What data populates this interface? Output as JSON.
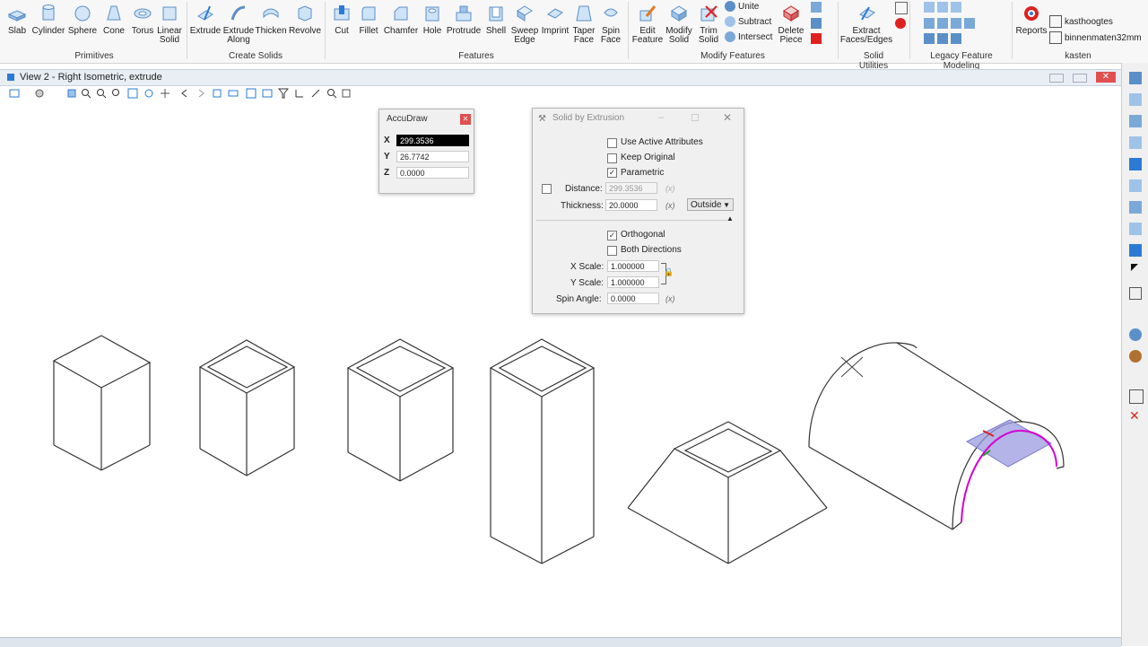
{
  "ribbon": {
    "groups": [
      {
        "label": "Primitives"
      },
      {
        "label": "Create Solids"
      },
      {
        "label": "Features"
      },
      {
        "label": "Modify Features"
      },
      {
        "label": "Solid Utilities"
      },
      {
        "label": "Legacy Feature Modeling"
      },
      {
        "label": "kasten"
      }
    ],
    "buttons": [
      {
        "label": "Slab"
      },
      {
        "label": "Cylinder"
      },
      {
        "label": "Sphere"
      },
      {
        "label": "Cone"
      },
      {
        "label": "Torus"
      },
      {
        "label": "Linear Solid"
      },
      {
        "label": "Extrude"
      },
      {
        "label": "Extrude Along"
      },
      {
        "label": "Thicken"
      },
      {
        "label": "Revolve"
      },
      {
        "label": "Cut"
      },
      {
        "label": "Fillet"
      },
      {
        "label": "Chamfer"
      },
      {
        "label": "Hole"
      },
      {
        "label": "Protrude"
      },
      {
        "label": "Shell"
      },
      {
        "label": "Sweep Edge"
      },
      {
        "label": "Imprint"
      },
      {
        "label": "Taper Face"
      },
      {
        "label": "Spin Face"
      },
      {
        "label": "Edit Feature"
      },
      {
        "label": "Modify Solid"
      },
      {
        "label": "Trim Solid"
      },
      {
        "label": "Delete Piece"
      },
      {
        "label": "Extract Faces/Edges"
      },
      {
        "label": "Reports"
      }
    ],
    "boolean": {
      "unite": "Unite",
      "subtract": "Subtract",
      "intersect": "Intersect"
    },
    "kasten": {
      "item1": "kasthoogtes",
      "item2": "binnenmaten32mm"
    }
  },
  "view": {
    "title": "View 2 - Right Isometric, extrude"
  },
  "accudraw": {
    "title": "AccuDraw",
    "x_label": "X",
    "x_value": "299.3536",
    "y_label": "Y",
    "y_value": "26.7742",
    "z_label": "Z",
    "z_value": "0.0000"
  },
  "extrusion": {
    "title": "Solid by Extrusion",
    "use_active": "Use Active Attributes",
    "keep_original": "Keep Original",
    "parametric": "Parametric",
    "distance_label": "Distance:",
    "distance_value": "299.3536",
    "thickness_label": "Thickness:",
    "thickness_value": "20.0000",
    "outside": "Outside",
    "orthogonal": "Orthogonal",
    "both_directions": "Both Directions",
    "xscale_label": "X Scale:",
    "xscale_value": "1.000000",
    "yscale_label": "Y Scale:",
    "yscale_value": "1.000000",
    "spin_label": "Spin Angle:",
    "spin_value": "0.0000",
    "x_token": "(x)",
    "checks": {
      "use_active": false,
      "keep_original": false,
      "parametric": true,
      "distance": false,
      "orthogonal": true,
      "both_directions": false
    }
  },
  "colors": {
    "accent": "#2b7bd6",
    "select_fill": "#9b9be0",
    "highlight": "#d400d4",
    "red": "#e02020"
  }
}
